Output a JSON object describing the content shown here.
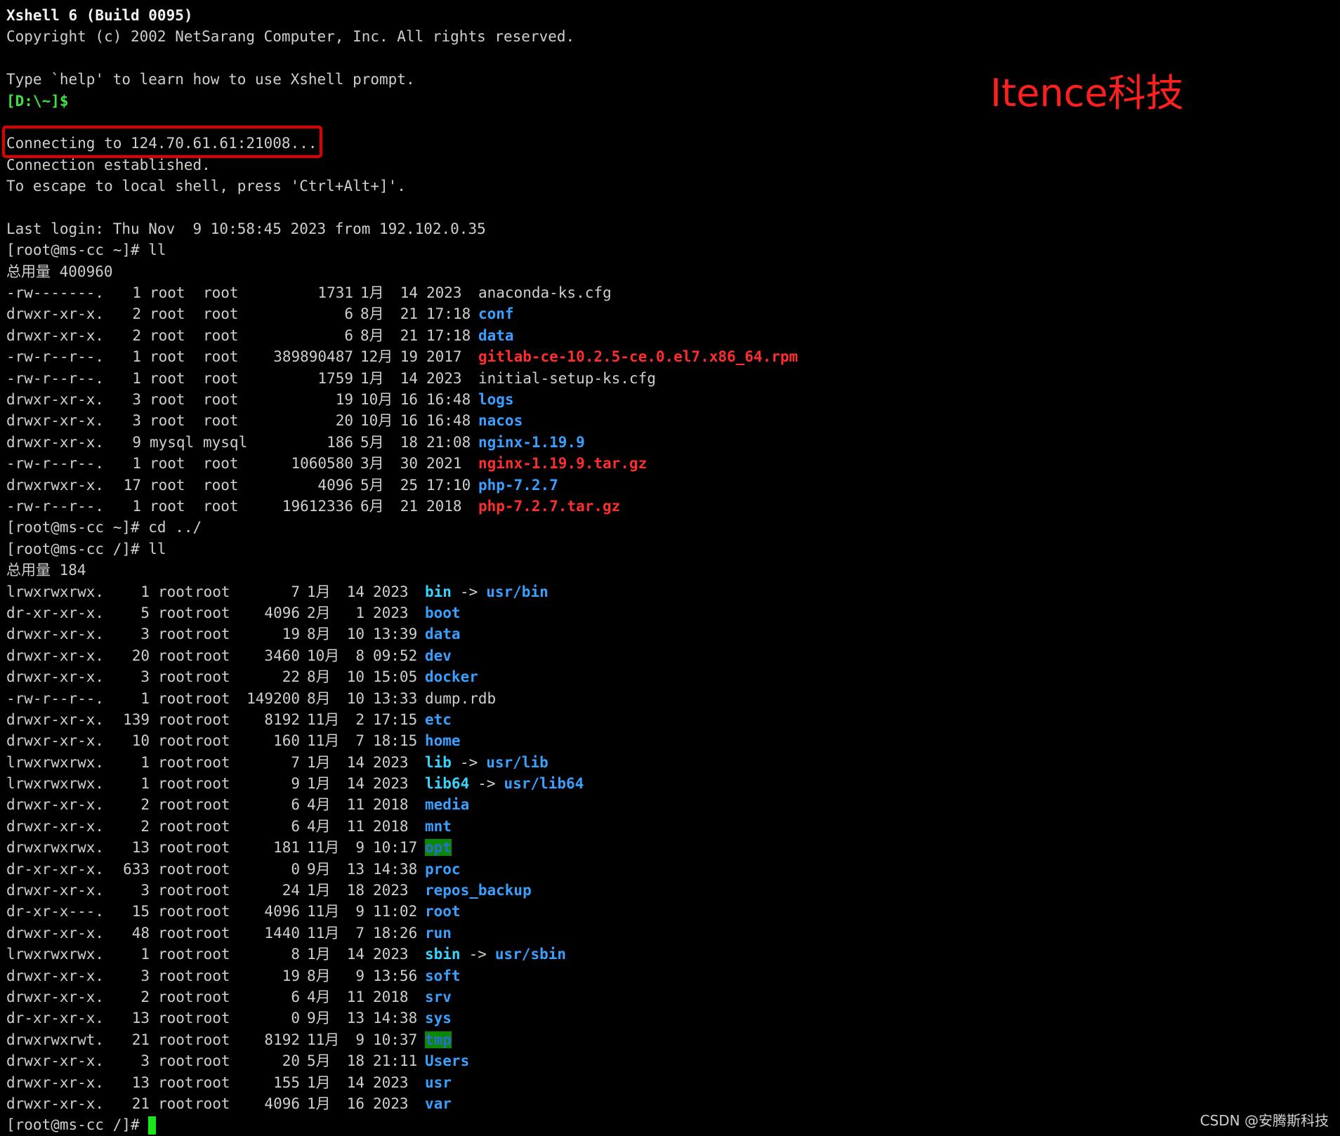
{
  "header": {
    "title": "Xshell 6 (Build 0095)",
    "copyright": "Copyright (c) 2002 NetSarang Computer, Inc. All rights reserved.",
    "help_hint": "Type `help' to learn how to use Xshell prompt.",
    "local_prompt": "[D:\\~]$"
  },
  "connection": {
    "connecting": "Connecting to 124.70.61.61:21008...",
    "established": "Connection established.",
    "escape_hint": "To escape to local shell, press 'Ctrl+Alt+]'.",
    "last_login": "Last login: Thu Nov  9 10:58:45 2023 from 192.102.0.35"
  },
  "session1": {
    "prompt": "[root@ms-cc ~]# ll",
    "total": "总用量 400960",
    "files": [
      {
        "perm": "-rw-------.",
        "links": "1",
        "user": "root",
        "group": "root",
        "size": "1731",
        "month": "1月",
        "day": "14",
        "time": "2023",
        "name": "anaconda-ks.cfg",
        "type": "file"
      },
      {
        "perm": "drwxr-xr-x.",
        "links": "2",
        "user": "root",
        "group": "root",
        "size": "6",
        "month": "8月",
        "day": "21",
        "time": "17:18",
        "name": "conf",
        "type": "dir"
      },
      {
        "perm": "drwxr-xr-x.",
        "links": "2",
        "user": "root",
        "group": "root",
        "size": "6",
        "month": "8月",
        "day": "21",
        "time": "17:18",
        "name": "data",
        "type": "dir"
      },
      {
        "perm": "-rw-r--r--.",
        "links": "1",
        "user": "root",
        "group": "root",
        "size": "389890487",
        "month": "12月",
        "day": "19",
        "time": "2017",
        "name": "gitlab-ce-10.2.5-ce.0.el7.x86_64.rpm",
        "type": "arch"
      },
      {
        "perm": "-rw-r--r--.",
        "links": "1",
        "user": "root",
        "group": "root",
        "size": "1759",
        "month": "1月",
        "day": "14",
        "time": "2023",
        "name": "initial-setup-ks.cfg",
        "type": "file"
      },
      {
        "perm": "drwxr-xr-x.",
        "links": "3",
        "user": "root",
        "group": "root",
        "size": "19",
        "month": "10月",
        "day": "16",
        "time": "16:48",
        "name": "logs",
        "type": "dir"
      },
      {
        "perm": "drwxr-xr-x.",
        "links": "3",
        "user": "root",
        "group": "root",
        "size": "20",
        "month": "10月",
        "day": "16",
        "time": "16:48",
        "name": "nacos",
        "type": "dir"
      },
      {
        "perm": "drwxr-xr-x.",
        "links": "9",
        "user": "mysql",
        "group": "mysql",
        "size": "186",
        "month": "5月",
        "day": "18",
        "time": "21:08",
        "name": "nginx-1.19.9",
        "type": "dir"
      },
      {
        "perm": "-rw-r--r--.",
        "links": "1",
        "user": "root",
        "group": "root",
        "size": "1060580",
        "month": "3月",
        "day": "30",
        "time": "2021",
        "name": "nginx-1.19.9.tar.gz",
        "type": "arch"
      },
      {
        "perm": "drwxrwxr-x.",
        "links": "17",
        "user": "root",
        "group": "root",
        "size": "4096",
        "month": "5月",
        "day": "25",
        "time": "17:10",
        "name": "php-7.2.7",
        "type": "dir"
      },
      {
        "perm": "-rw-r--r--.",
        "links": "1",
        "user": "root",
        "group": "root",
        "size": "19612336",
        "month": "6月",
        "day": "21",
        "time": "2018",
        "name": "php-7.2.7.tar.gz",
        "type": "arch"
      }
    ]
  },
  "session2": {
    "cd": "[root@ms-cc ~]# cd ../",
    "prompt": "[root@ms-cc /]# ll",
    "total": "总用量 184",
    "files": [
      {
        "perm": "lrwxrwxrwx.",
        "links": "1",
        "user": "root",
        "group": "root",
        "size": "7",
        "month": "1月",
        "day": "14",
        "time": "2023",
        "name": "bin",
        "type": "link",
        "target": "usr/bin"
      },
      {
        "perm": "dr-xr-xr-x.",
        "links": "5",
        "user": "root",
        "group": "root",
        "size": "4096",
        "month": "2月",
        "day": "1",
        "time": "2023",
        "name": "boot",
        "type": "dir"
      },
      {
        "perm": "drwxr-xr-x.",
        "links": "3",
        "user": "root",
        "group": "root",
        "size": "19",
        "month": "8月",
        "day": "10",
        "time": "13:39",
        "name": "data",
        "type": "dir"
      },
      {
        "perm": "drwxr-xr-x.",
        "links": "20",
        "user": "root",
        "group": "root",
        "size": "3460",
        "month": "10月",
        "day": "8",
        "time": "09:52",
        "name": "dev",
        "type": "dir"
      },
      {
        "perm": "drwxr-xr-x.",
        "links": "3",
        "user": "root",
        "group": "root",
        "size": "22",
        "month": "8月",
        "day": "10",
        "time": "15:05",
        "name": "docker",
        "type": "dir"
      },
      {
        "perm": "-rw-r--r--.",
        "links": "1",
        "user": "root",
        "group": "root",
        "size": "149200",
        "month": "8月",
        "day": "10",
        "time": "13:33",
        "name": "dump.rdb",
        "type": "file"
      },
      {
        "perm": "drwxr-xr-x.",
        "links": "139",
        "user": "root",
        "group": "root",
        "size": "8192",
        "month": "11月",
        "day": "2",
        "time": "17:15",
        "name": "etc",
        "type": "dir"
      },
      {
        "perm": "drwxr-xr-x.",
        "links": "10",
        "user": "root",
        "group": "root",
        "size": "160",
        "month": "11月",
        "day": "7",
        "time": "18:15",
        "name": "home",
        "type": "dir"
      },
      {
        "perm": "lrwxrwxrwx.",
        "links": "1",
        "user": "root",
        "group": "root",
        "size": "7",
        "month": "1月",
        "day": "14",
        "time": "2023",
        "name": "lib",
        "type": "link",
        "target": "usr/lib"
      },
      {
        "perm": "lrwxrwxrwx.",
        "links": "1",
        "user": "root",
        "group": "root",
        "size": "9",
        "month": "1月",
        "day": "14",
        "time": "2023",
        "name": "lib64",
        "type": "link",
        "target": "usr/lib64"
      },
      {
        "perm": "drwxr-xr-x.",
        "links": "2",
        "user": "root",
        "group": "root",
        "size": "6",
        "month": "4月",
        "day": "11",
        "time": "2018",
        "name": "media",
        "type": "dir"
      },
      {
        "perm": "drwxr-xr-x.",
        "links": "2",
        "user": "root",
        "group": "root",
        "size": "6",
        "month": "4月",
        "day": "11",
        "time": "2018",
        "name": "mnt",
        "type": "dir"
      },
      {
        "perm": "drwxrwxrwx.",
        "links": "13",
        "user": "root",
        "group": "root",
        "size": "181",
        "month": "11月",
        "day": "9",
        "time": "10:17",
        "name": "opt",
        "type": "hl"
      },
      {
        "perm": "dr-xr-xr-x.",
        "links": "633",
        "user": "root",
        "group": "root",
        "size": "0",
        "month": "9月",
        "day": "13",
        "time": "14:38",
        "name": "proc",
        "type": "dir"
      },
      {
        "perm": "drwxr-xr-x.",
        "links": "3",
        "user": "root",
        "group": "root",
        "size": "24",
        "month": "1月",
        "day": "18",
        "time": "2023",
        "name": "repos_backup",
        "type": "dir"
      },
      {
        "perm": "dr-xr-x---.",
        "links": "15",
        "user": "root",
        "group": "root",
        "size": "4096",
        "month": "11月",
        "day": "9",
        "time": "11:02",
        "name": "root",
        "type": "dir"
      },
      {
        "perm": "drwxr-xr-x.",
        "links": "48",
        "user": "root",
        "group": "root",
        "size": "1440",
        "month": "11月",
        "day": "7",
        "time": "18:26",
        "name": "run",
        "type": "dir"
      },
      {
        "perm": "lrwxrwxrwx.",
        "links": "1",
        "user": "root",
        "group": "root",
        "size": "8",
        "month": "1月",
        "day": "14",
        "time": "2023",
        "name": "sbin",
        "type": "link",
        "target": "usr/sbin"
      },
      {
        "perm": "drwxr-xr-x.",
        "links": "3",
        "user": "root",
        "group": "root",
        "size": "19",
        "month": "8月",
        "day": "9",
        "time": "13:56",
        "name": "soft",
        "type": "dir"
      },
      {
        "perm": "drwxr-xr-x.",
        "links": "2",
        "user": "root",
        "group": "root",
        "size": "6",
        "month": "4月",
        "day": "11",
        "time": "2018",
        "name": "srv",
        "type": "dir"
      },
      {
        "perm": "dr-xr-xr-x.",
        "links": "13",
        "user": "root",
        "group": "root",
        "size": "0",
        "month": "9月",
        "day": "13",
        "time": "14:38",
        "name": "sys",
        "type": "dir"
      },
      {
        "perm": "drwxrwxrwt.",
        "links": "21",
        "user": "root",
        "group": "root",
        "size": "8192",
        "month": "11月",
        "day": "9",
        "time": "10:37",
        "name": "tmp",
        "type": "hl"
      },
      {
        "perm": "drwxr-xr-x.",
        "links": "3",
        "user": "root",
        "group": "root",
        "size": "20",
        "month": "5月",
        "day": "18",
        "time": "21:11",
        "name": "Users",
        "type": "dir"
      },
      {
        "perm": "drwxr-xr-x.",
        "links": "13",
        "user": "root",
        "group": "root",
        "size": "155",
        "month": "1月",
        "day": "14",
        "time": "2023",
        "name": "usr",
        "type": "dir"
      },
      {
        "perm": "drwxr-xr-x.",
        "links": "21",
        "user": "root",
        "group": "root",
        "size": "4096",
        "month": "1月",
        "day": "16",
        "time": "2023",
        "name": "var",
        "type": "dir"
      }
    ],
    "final_prompt": "[root@ms-cc /]# "
  },
  "arrow": "->",
  "watermark": "Itence科技",
  "footer": "CSDN @安腾斯科技",
  "colors": {
    "background": "#000000",
    "text": "#cfcfcf",
    "dir": "#3aa0ff",
    "archive": "#ff2e2e",
    "link": "#36d6ff",
    "prompt_green": "#3fe33f",
    "highlight_bg": "#0a8a00",
    "red_box": "#e10000"
  }
}
